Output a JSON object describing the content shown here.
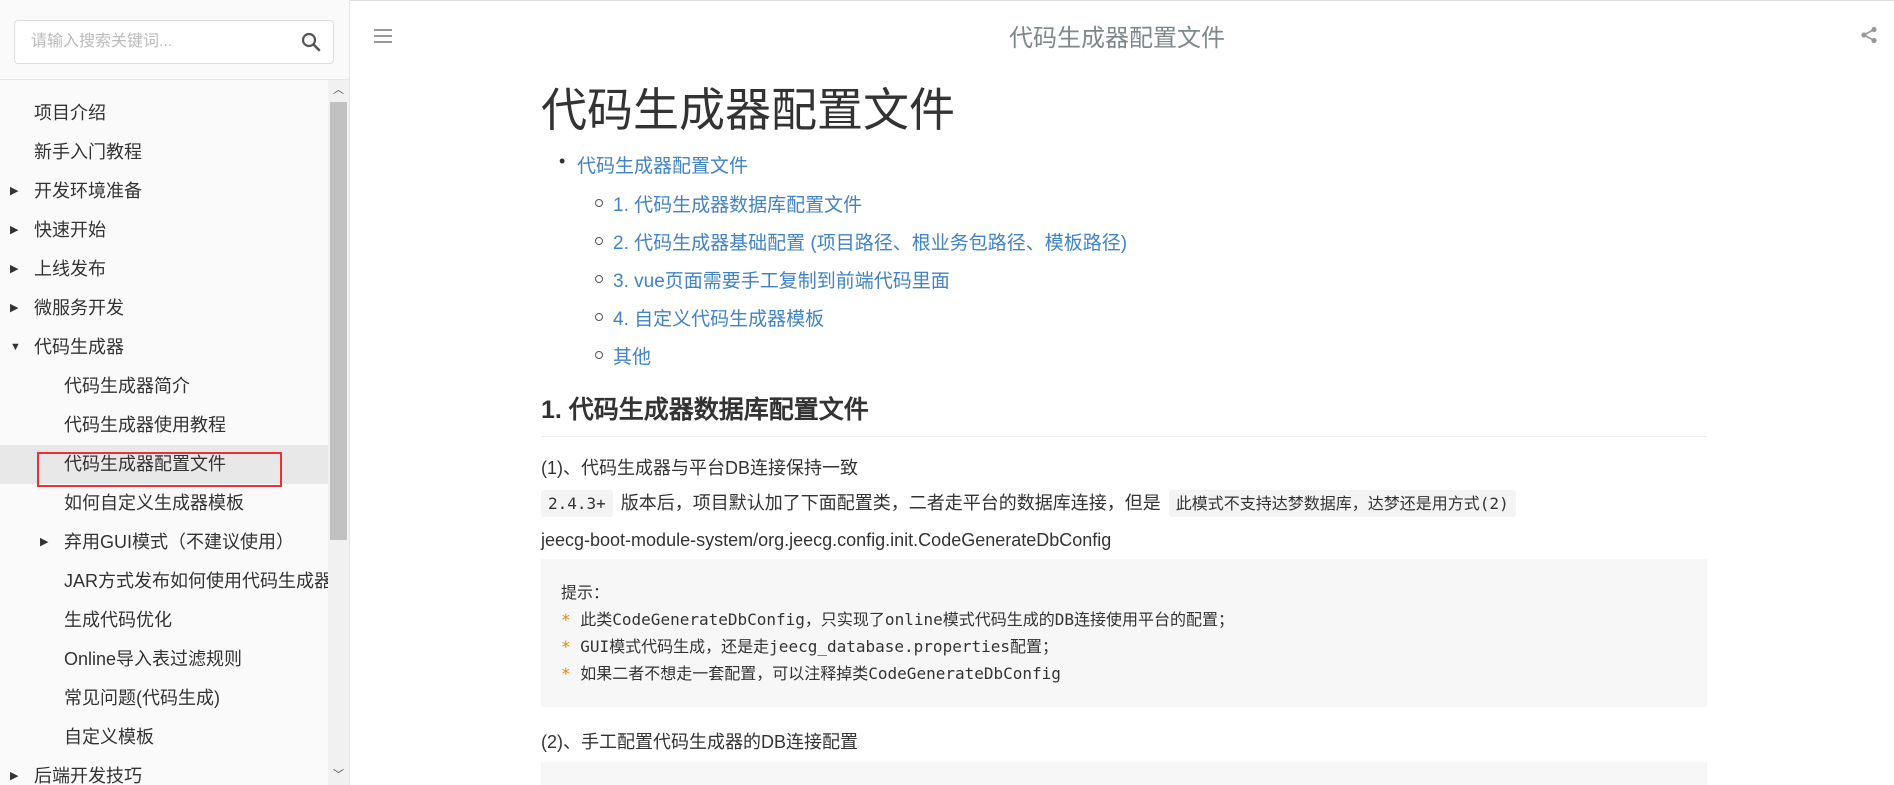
{
  "search": {
    "placeholder": "请输入搜索关键词..."
  },
  "sidebar": {
    "items": [
      {
        "label": "项目介绍",
        "has_arrow": false,
        "expanded": false,
        "level": 1
      },
      {
        "label": "新手入门教程",
        "has_arrow": false,
        "expanded": false,
        "level": 1
      },
      {
        "label": "开发环境准备",
        "has_arrow": true,
        "expanded": false,
        "level": 1
      },
      {
        "label": "快速开始",
        "has_arrow": true,
        "expanded": false,
        "level": 1
      },
      {
        "label": "上线发布",
        "has_arrow": true,
        "expanded": false,
        "level": 1
      },
      {
        "label": "微服务开发",
        "has_arrow": true,
        "expanded": false,
        "level": 1
      },
      {
        "label": "代码生成器",
        "has_arrow": true,
        "expanded": true,
        "level": 1
      },
      {
        "label": "代码生成器简介",
        "has_arrow": false,
        "expanded": false,
        "level": 2
      },
      {
        "label": "代码生成器使用教程",
        "has_arrow": false,
        "expanded": false,
        "level": 2
      },
      {
        "label": "代码生成器配置文件",
        "has_arrow": false,
        "expanded": false,
        "level": 2,
        "active": true
      },
      {
        "label": "如何自定义生成器模板",
        "has_arrow": false,
        "expanded": false,
        "level": 2
      },
      {
        "label": "弃用GUI模式（不建议使用）",
        "has_arrow": true,
        "expanded": false,
        "level": 2
      },
      {
        "label": "JAR方式发布如何使用代码生成器",
        "has_arrow": false,
        "expanded": false,
        "level": 2
      },
      {
        "label": "生成代码优化",
        "has_arrow": false,
        "expanded": false,
        "level": 2
      },
      {
        "label": "Online导入表过滤规则",
        "has_arrow": false,
        "expanded": false,
        "level": 2
      },
      {
        "label": "常见问题(代码生成)",
        "has_arrow": false,
        "expanded": false,
        "level": 2
      },
      {
        "label": "自定义模板",
        "has_arrow": false,
        "expanded": false,
        "level": 2
      },
      {
        "label": "后端开发技巧",
        "has_arrow": true,
        "expanded": false,
        "level": 1
      }
    ]
  },
  "header": {
    "title": "代码生成器配置文件"
  },
  "main": {
    "title": "代码生成器配置文件",
    "toc": {
      "root": "代码生成器配置文件",
      "children": [
        "1. 代码生成器数据库配置文件",
        "2. 代码生成器基础配置 (项目路径、根业务包路径、模板路径)",
        "3. vue页面需要手工复制到前端代码里面",
        "4. 自定义代码生成器模板",
        "其他"
      ]
    },
    "section1_heading": "1. 代码生成器数据库配置文件",
    "para1": "(1)、代码生成器与平台DB连接保持一致",
    "version_code": "2.4.3+",
    "para2_text": "版本后，项目默认加了下面配置类，二者走平台的数据库连接，但是",
    "para2_code": "此模式不支持达梦数据库，达梦还是用方式(2)",
    "class_path": "jeecg-boot-module-system/org.jeecg.config.init.CodeGenerateDbConfig",
    "code_block": {
      "line1": "提示：",
      "star": "*",
      "line2": " 此类CodeGenerateDbConfig，只实现了online模式代码生成的DB连接使用平台的配置；",
      "line3": " GUI模式代码生成，还是走jeecg_database.properties配置；",
      "line4": " 如果二者不想走一套配置，可以注释掉类CodeGenerateDbConfig"
    },
    "para3": "(2)、手工配置代码生成器的DB连接配置"
  }
}
